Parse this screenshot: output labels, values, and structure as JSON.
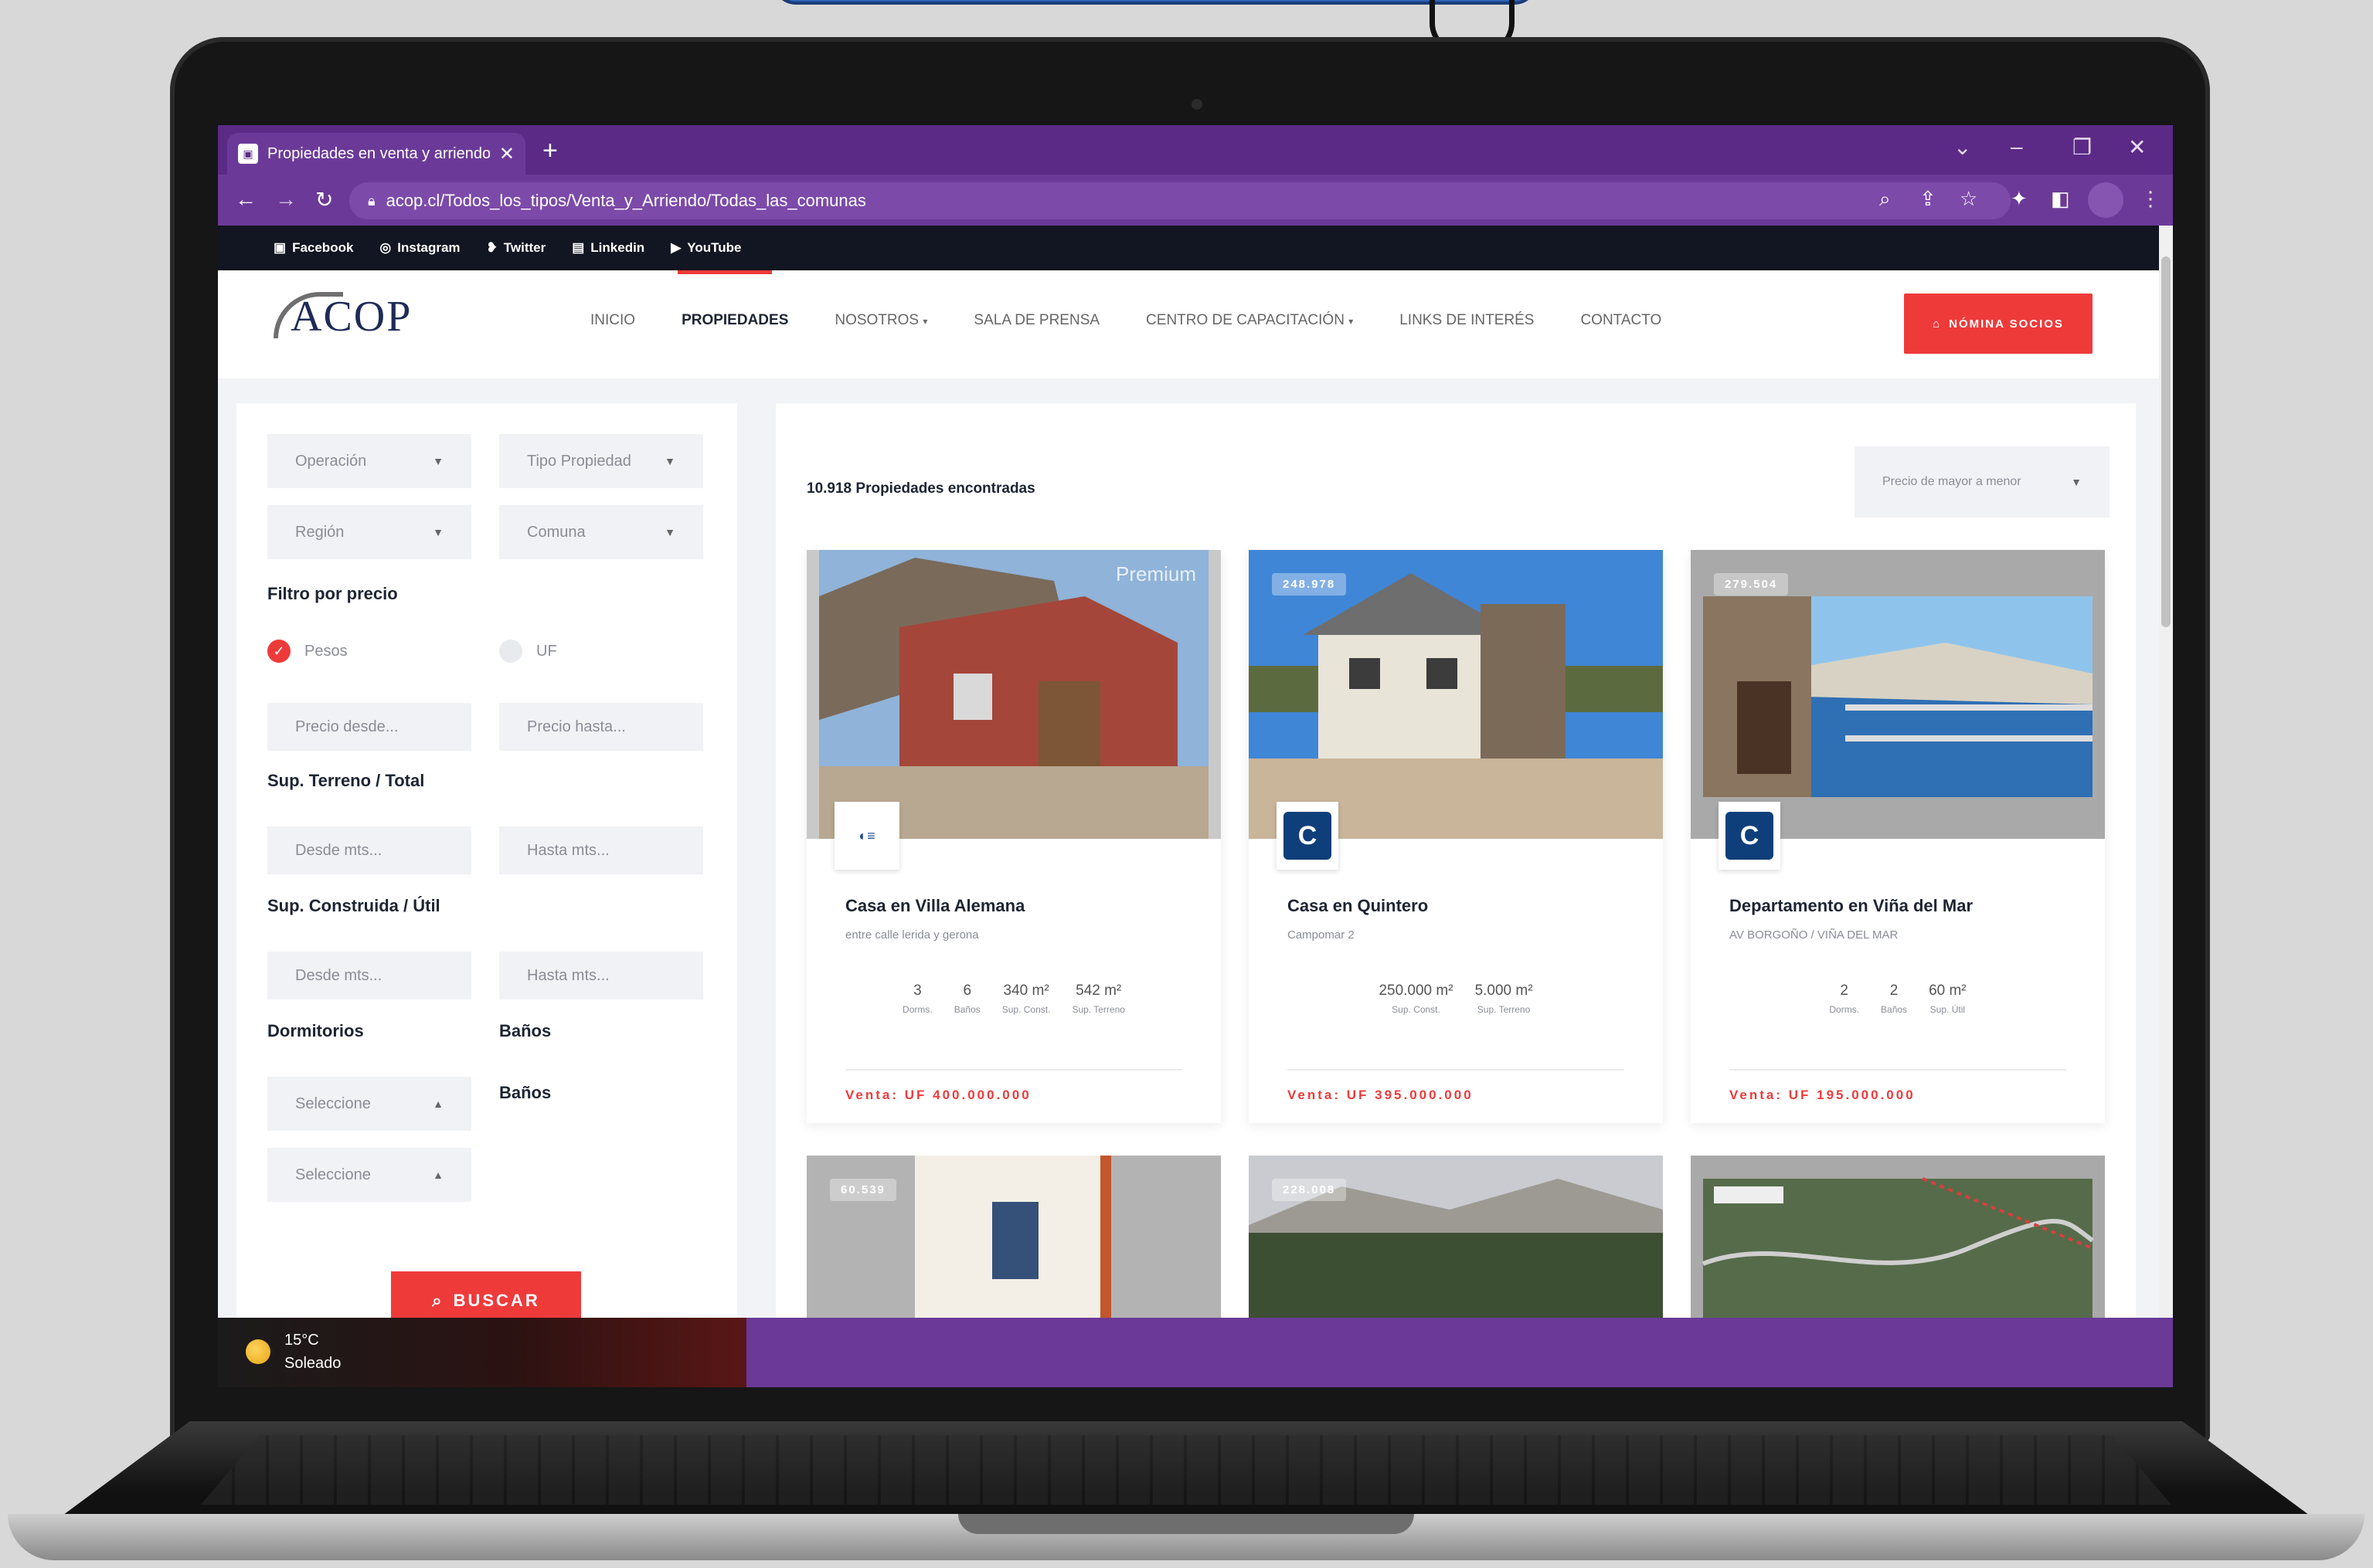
{
  "browser": {
    "tab_title": "Propiedades en venta y arriendo",
    "url": "acop.cl/Todos_los_tipos/Venta_y_Arriendo/Todas_las_comunas"
  },
  "social": [
    {
      "icon": "facebook-icon",
      "label": "Facebook"
    },
    {
      "icon": "instagram-icon",
      "label": "Instagram"
    },
    {
      "icon": "twitter-icon",
      "label": "Twitter"
    },
    {
      "icon": "linkedin-icon",
      "label": "Linkedin"
    },
    {
      "icon": "youtube-icon",
      "label": "YouTube"
    }
  ],
  "header": {
    "logo_text": "ACOP",
    "nav": [
      "INICIO",
      "PROPIEDADES",
      "NOSOTROS",
      "SALA DE PRENSA",
      "CENTRO DE CAPACITACIÓN",
      "LINKS DE INTERÉS",
      "CONTACTO"
    ],
    "active_nav": "PROPIEDADES",
    "cta_label": "NÓMINA SOCIOS"
  },
  "filters": {
    "operacion": "Operación",
    "tipo_propiedad": "Tipo Propiedad",
    "region": "Región",
    "comuna": "Comuna",
    "precio_title": "Filtro por precio",
    "currency_pesos": "Pesos",
    "currency_uf": "UF",
    "selected_currency": "Pesos",
    "precio_desde": "Precio desde...",
    "precio_hasta": "Precio hasta...",
    "terreno_title": "Sup. Terreno / Total",
    "terreno_desde": "Desde mts...",
    "terreno_hasta": "Hasta mts...",
    "construida_title": "Sup. Construida / Útil",
    "construida_desde": "Desde mts...",
    "construida_hasta": "Hasta mts...",
    "dormitorios_title": "Dormitorios",
    "banos_title": "Baños",
    "banos_label": "Baños",
    "dorm_select": "Seleccione",
    "banos_select": "Seleccione",
    "search_label": "BUSCAR"
  },
  "results": {
    "count_text": "10.918 Propiedades encontradas",
    "sort_label": "Precio de mayor a menor"
  },
  "cards": [
    {
      "badge": "",
      "agency_label": "",
      "title": "Casa en Villa Alemana",
      "address": "entre calle lerida y gerona",
      "features": [
        {
          "value": "3",
          "label": "Dorms."
        },
        {
          "value": "6",
          "label": "Baños"
        },
        {
          "value": "340 m²",
          "label": "Sup. Const."
        },
        {
          "value": "542 m²",
          "label": "Sup. Terreno"
        }
      ],
      "price": "Venta: UF 400.000.000"
    },
    {
      "badge": "248.978",
      "agency_label": "",
      "title": "Casa en Quintero",
      "address": "Campomar 2",
      "features": [
        {
          "value": "250.000 m²",
          "label": "Sup. Const."
        },
        {
          "value": "5.000 m²",
          "label": "Sup. Terreno"
        }
      ],
      "price": "Venta: UF 395.000.000"
    },
    {
      "badge": "279.504",
      "agency_label": "",
      "title": "Departamento en Viña del Mar",
      "address": "AV BORGOÑO / VIÑA DEL MAR",
      "features": [
        {
          "value": "2",
          "label": "Dorms."
        },
        {
          "value": "2",
          "label": "Baños"
        },
        {
          "value": "60 m²",
          "label": "Sup. Útil"
        }
      ],
      "price": "Venta: UF 195.000.000"
    }
  ],
  "cards_second_row": [
    {
      "badge": "60.539"
    },
    {
      "badge": "228.008"
    },
    {
      "badge": ""
    }
  ],
  "taskbar": {
    "temperature": "15°C",
    "weather": "Soleado"
  },
  "colors": {
    "accent": "#ef3a3a",
    "browser_purple": "#6b3a98",
    "navy": "#121522"
  }
}
